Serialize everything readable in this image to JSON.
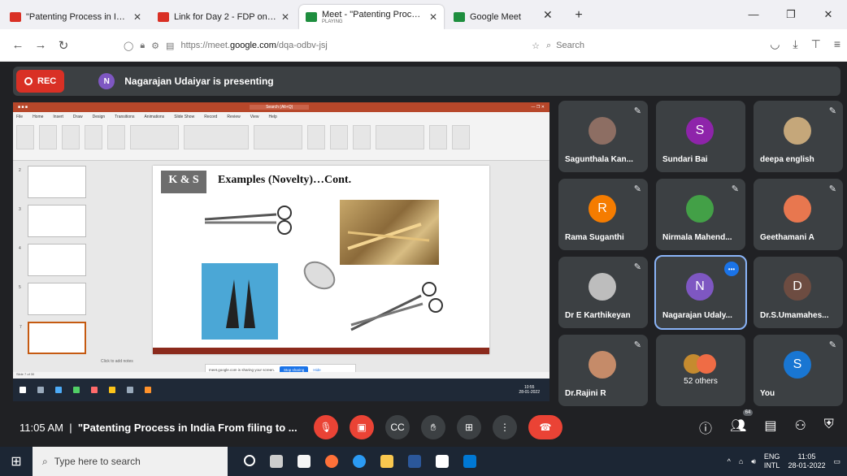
{
  "browser": {
    "tabs": [
      {
        "title": "\"Patenting Process in India Fro",
        "favicon_color": "#d93025"
      },
      {
        "title": "Link for Day 2 - FDP on IPR - gm",
        "favicon_color": "#d93025"
      },
      {
        "title": "Meet - \"Patenting Process in Ind",
        "subtitle": "PLAYING",
        "favicon_color": "#1e8e3e",
        "active": true
      },
      {
        "title": "Google Meet",
        "favicon_color": "#1e8e3e"
      }
    ],
    "new_tab": "+",
    "url_prefix": "https://meet.",
    "url_domain": "google.com",
    "url_path": "/dqa-odbv-jsj",
    "search_placeholder": "Search"
  },
  "meet": {
    "rec_label": "REC",
    "presenter_initial": "N",
    "presenter_color": "#7e57c2",
    "presenting_text": "Nagarajan Udaiyar is presenting",
    "slide": {
      "logo_text": "K & S",
      "title": "Examples (Novelty)…Cont.",
      "notes_placeholder": "Click to add notes",
      "share_text": "meet.google.com is sharing your screen.",
      "stop_sharing": "Stop sharing",
      "hide": "Hide",
      "ppt_search": "Search (Alt+Q)",
      "ppt_menus": [
        "File",
        "Home",
        "Insert",
        "Draw",
        "Design",
        "Transitions",
        "Animations",
        "Slide Show",
        "Record",
        "Review",
        "View",
        "Help"
      ],
      "status_left": "Slide 7 of 30",
      "taskbar_time": "10:55",
      "taskbar_date": "28-01-2022"
    },
    "participants": [
      {
        "name": "Sagunthala Kan...",
        "type": "photo",
        "color": "#8d6e63"
      },
      {
        "name": "Sundari Bai",
        "initial": "S",
        "color": "#8e24aa"
      },
      {
        "name": "deepa english",
        "type": "photo",
        "color": "#c5a77a"
      },
      {
        "name": "Rama Suganthi",
        "initial": "R",
        "color": "#f57c00"
      },
      {
        "name": "Nirmala Mahend...",
        "type": "photo",
        "color": "#43a047"
      },
      {
        "name": "Geethamani A",
        "type": "photo",
        "color": "#e8774f"
      },
      {
        "name": "Dr E Karthikeyan",
        "type": "photo",
        "color": "#bdbdbd"
      },
      {
        "name": "Nagarajan Udaly...",
        "initial": "N",
        "color": "#7e57c2",
        "speaking": true
      },
      {
        "name": "Dr.S.Umamahes...",
        "initial": "D",
        "color": "#6d4c41"
      },
      {
        "name": "Dr.Rajini R",
        "type": "photo",
        "color": "#c58b69"
      },
      {
        "name": "52 others",
        "type": "others"
      },
      {
        "name": "You",
        "initial": "S",
        "color": "#1976d2"
      }
    ],
    "meeting_time": "11:05 AM",
    "meeting_title": "\"Patenting Process in India From filing to ...",
    "people_count": "64"
  },
  "taskbar": {
    "search_placeholder": "Type here to search",
    "lang": "ENG",
    "region": "INTL",
    "time": "11:05",
    "date": "28-01-2022"
  }
}
